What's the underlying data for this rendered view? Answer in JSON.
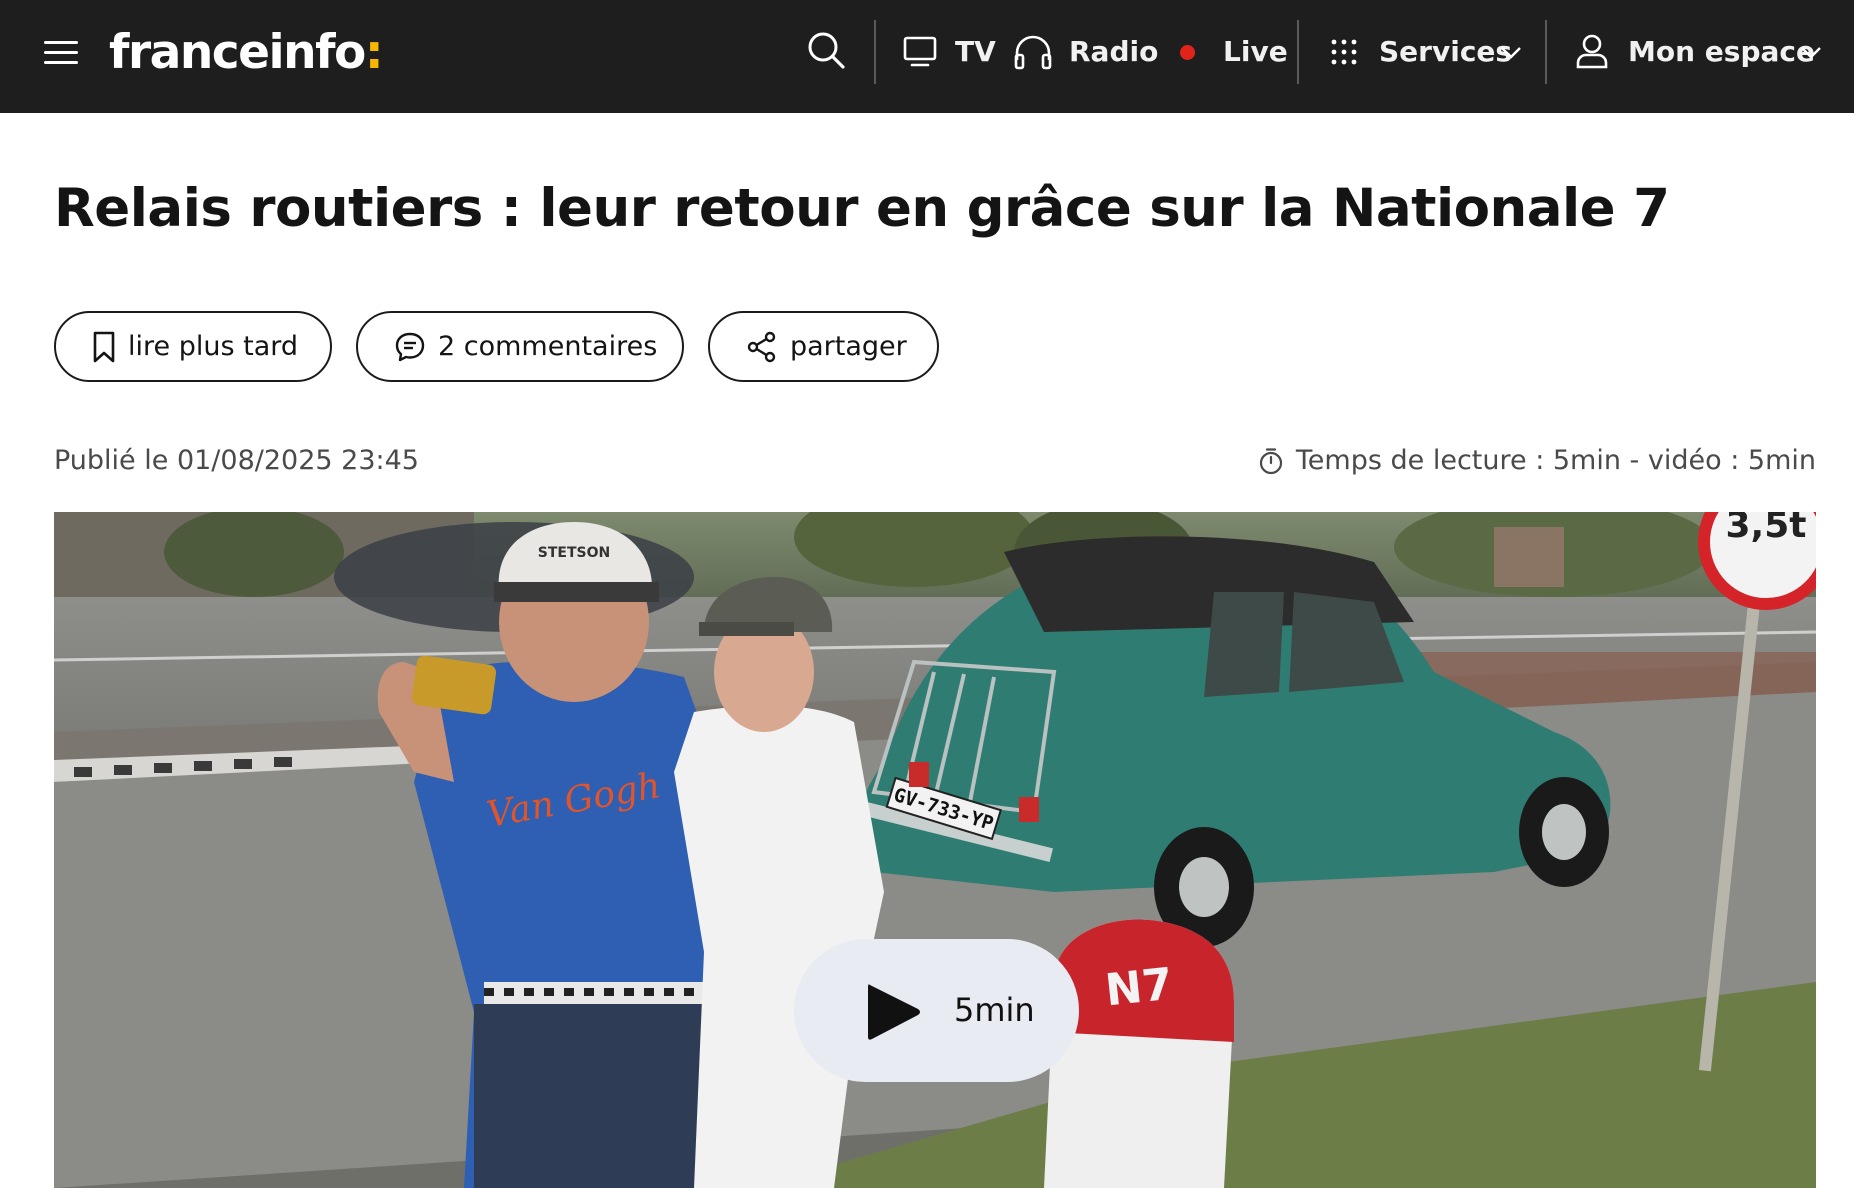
{
  "header": {
    "logo_text": "franceinfo",
    "logo_colon": ":",
    "logo_accent_color": "#f7b600",
    "menu_icon": "hamburger-menu-icon",
    "search_icon": "search-icon",
    "nav": {
      "tv_label": "TV",
      "radio_label": "Radio",
      "live_label": "Live",
      "services_label": "Services",
      "account_label": "Mon espace"
    },
    "live_dot_color": "#e2231a"
  },
  "article": {
    "title": "Relais routiers : leur retour en grâce sur la Nationale 7",
    "actions": {
      "read_later": "lire plus tard",
      "comments": "2 commentaires",
      "share": "partager"
    },
    "published": "Publié le 01/08/2025 23:45",
    "reading_time": "Temps de lecture : 5min - vidéo : 5min"
  },
  "video": {
    "duration": "5min",
    "license_plate": "GV-733-YP",
    "milestone_text": "N7",
    "road_sign_text": "3,5t",
    "cap_text": "STETSON",
    "shirt_text": "Van Gogh"
  }
}
